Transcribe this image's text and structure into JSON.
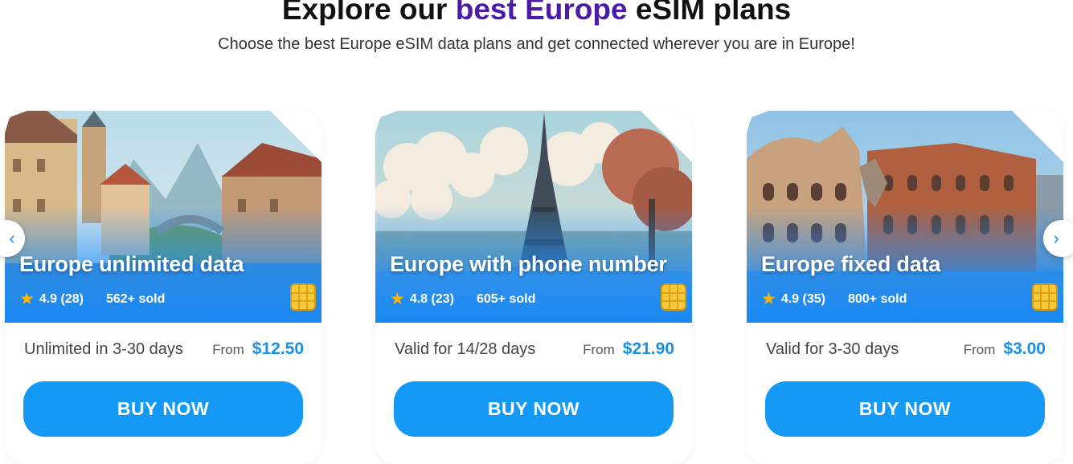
{
  "header": {
    "title_before": "Explore our",
    "title_accent": "best Europe",
    "title_after": "eSIM plans",
    "subtitle": "Choose the best Europe eSIM data plans and get connected wherever you are in Europe!"
  },
  "carousel": {
    "prev_icon": "‹",
    "next_icon": "›"
  },
  "plans": [
    {
      "title": "Europe unlimited data",
      "rating": "4.9 (28)",
      "sold": "562+ sold",
      "validity": "Unlimited in 3-30 days",
      "from_label": "From",
      "price": "$12.50",
      "button_label": "BUY NOW",
      "image": "european-canal-town-illustration"
    },
    {
      "title": "Europe with phone number",
      "rating": "4.8 (23)",
      "sold": "605+ sold",
      "validity": "Valid for 14/28 days",
      "from_label": "From",
      "price": "$21.90",
      "button_label": "BUY NOW",
      "image": "eiffel-tower-illustration"
    },
    {
      "title": "Europe fixed data",
      "rating": "4.9 (35)",
      "sold": "800+ sold",
      "validity": "Valid for 3-30 days",
      "from_label": "From",
      "price": "$3.00",
      "button_label": "BUY NOW",
      "image": "colosseum-illustration"
    }
  ],
  "colors": {
    "accent": "#4a1aa8",
    "button": "#1499f7",
    "price": "#1a8fe8",
    "star": "#ffb400"
  }
}
